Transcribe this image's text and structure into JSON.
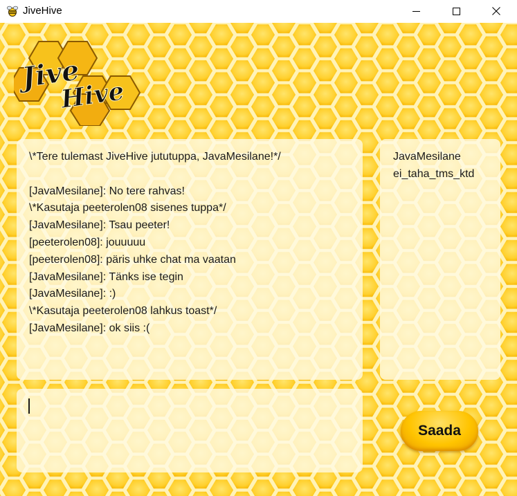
{
  "window": {
    "title": "JiveHive"
  },
  "logo": {
    "line1": "Jive",
    "line2": "Hive"
  },
  "chat": {
    "lines": [
      "\\*Tere tulemast JiveHive jututuppa, JavaMesilane!*/",
      "",
      "[JavaMesilane]: No tere rahvas!",
      "\\*Kasutaja peeterolen08 sisenes tuppa*/",
      "[JavaMesilane]: Tsau peeter!",
      "[peeterolen08]: jouuuuu",
      "[peeterolen08]: päris uhke chat ma vaatan",
      "[JavaMesilane]: Tänks ise tegin",
      "[JavaMesilane]: :)",
      "\\*Kasutaja peeterolen08 lahkus toast*/",
      "[JavaMesilane]: ok siis :("
    ]
  },
  "users": [
    "JavaMesilane",
    "ei_taha_tms_ktd"
  ],
  "message_input": {
    "value": ""
  },
  "send_button": {
    "label": "Saada"
  },
  "colors": {
    "honeycomb_fill": "#ffd23a",
    "honeycomb_line": "#fff6c8",
    "panel": "#fffae4"
  },
  "icons": {
    "app": "bee-icon",
    "minimize": "minimize-icon",
    "maximize": "maximize-icon",
    "close": "close-icon"
  }
}
